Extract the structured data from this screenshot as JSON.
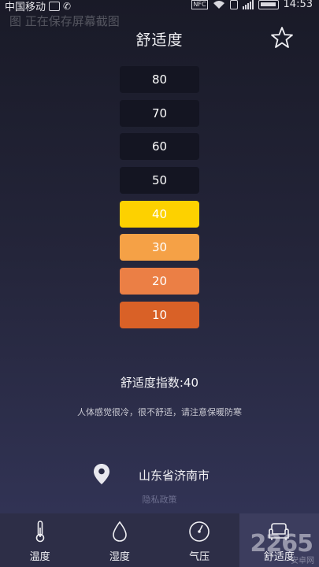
{
  "status_bar": {
    "carrier": "中国移动",
    "time": "14:53",
    "nfc_label": "NFC"
  },
  "ghost_text": "图 正在保存屏幕截图",
  "header": {
    "title": "舒适度"
  },
  "levels": [
    {
      "label": "80",
      "color": "#141522"
    },
    {
      "label": "70",
      "color": "#141522"
    },
    {
      "label": "60",
      "color": "#141522"
    },
    {
      "label": "50",
      "color": "#141522"
    },
    {
      "label": "40",
      "color": "#fdd100"
    },
    {
      "label": "30",
      "color": "#f5a146"
    },
    {
      "label": "20",
      "color": "#eb7f45"
    },
    {
      "label": "10",
      "color": "#d96127"
    }
  ],
  "comfort": {
    "index_text": "舒适度指数:40",
    "advice": "人体感觉很冷，很不舒适，请注意保暖防寒"
  },
  "location": {
    "name": "山东省济南市",
    "privacy": "隐私政策"
  },
  "nav": {
    "temperature": "温度",
    "humidity": "湿度",
    "pressure": "气压",
    "comfort": "舒适度"
  },
  "watermark": {
    "text": "2265",
    "sub": "安卓网"
  }
}
